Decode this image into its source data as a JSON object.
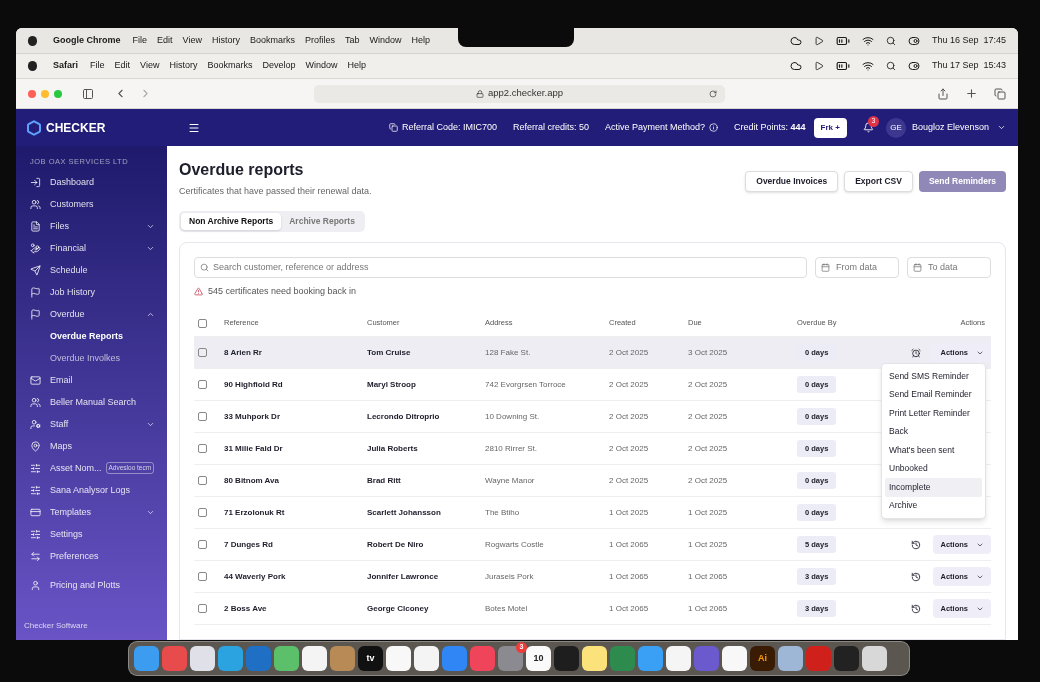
{
  "menubars": [
    {
      "app": "Google Chrome",
      "menus": [
        "File",
        "Edit",
        "View",
        "History",
        "Bookmarks",
        "Profiles",
        "Tab",
        "Window",
        "Help"
      ],
      "clock": "Thu 16 Sep  17:45"
    },
    {
      "app": "Safari",
      "menus": [
        "File",
        "Edit",
        "View",
        "History",
        "Bookmarks",
        "Develop",
        "Window",
        "Help"
      ],
      "clock": "Thu 17 Sep  15:43"
    }
  ],
  "browser": {
    "url": "app2.checker.app"
  },
  "header": {
    "logo": "CHECKER",
    "referral_code": "Referral Code: IMIC700",
    "referral_credits": "Referral credits: 50",
    "payment": "Active Payment Method?",
    "credit_points": "Credit Points: **444**",
    "plan_button": "Frk +",
    "notifications": "3",
    "avatar": "GE",
    "user": "Bougloz Elevenson"
  },
  "sidebar": {
    "company": "JOB OAX SERVICES LTD",
    "items": [
      {
        "label": "Dashboard"
      },
      {
        "label": "Customers"
      },
      {
        "label": "Files",
        "expanded": false
      },
      {
        "label": "Financial",
        "expanded": false
      },
      {
        "label": "Schedule"
      },
      {
        "label": "Job History"
      },
      {
        "label": "Overdue",
        "expanded": true,
        "children": [
          {
            "label": "Overdue Reports",
            "selected": true
          },
          {
            "label": "Overdue Involkes",
            "selected": false
          }
        ]
      },
      {
        "label": "Email"
      },
      {
        "label": "Beller Manual Search"
      },
      {
        "label": "Staff",
        "expanded": false
      },
      {
        "label": "Maps"
      },
      {
        "label": "Asset Nom...",
        "badge": "Advesloo tecm"
      },
      {
        "label": "Sana Analysor Logs"
      },
      {
        "label": "Templates",
        "expanded": false
      },
      {
        "label": "Settings"
      },
      {
        "label": "Preferences"
      },
      {
        "label": "Pricing and Plotts"
      }
    ],
    "footer": "Checker Software"
  },
  "page": {
    "title": "Overdue reports",
    "subtitle": "Certificates that have passed their renewal data.",
    "buttons": [
      {
        "label": "Overdue Invoices",
        "kind": "outline"
      },
      {
        "label": "Export CSV",
        "kind": "outline"
      },
      {
        "label": "Send Reminders",
        "kind": "primary"
      }
    ],
    "tabs": [
      {
        "label": "Non Archive Reports",
        "selected": true
      },
      {
        "label": "Archive Reports",
        "selected": false
      }
    ],
    "search": {
      "placeholder": "Search customer, reference or address"
    },
    "from_date": {
      "placeholder": "From data"
    },
    "to_date": {
      "placeholder": "To data"
    },
    "warning": "545 certificates need booking back in"
  },
  "table": {
    "select_all": {
      "checked": false
    },
    "columns": [
      "Reference",
      "Customer",
      "Address",
      "Created",
      "Due",
      "Overdue By",
      "Actions"
    ],
    "rows": [
      {
        "reference": "8 Arien Rr",
        "customer": "Tom Cruise",
        "address": "128 Fake St.",
        "created": "2 Oct 2025",
        "due": "3 Oct 2025",
        "overdue_by": "0 days",
        "actions": "Actions",
        "selected": true
      },
      {
        "reference": "90 Highfiold Rd",
        "customer": "Maryl Stroop",
        "address": "742 Evorgrsen Torroce",
        "created": "2 Oct 2025",
        "due": "2 Oct 2025",
        "overdue_by": "0 days",
        "selected": false
      },
      {
        "reference": "33 Muhpork Dr",
        "customer": "Lecrondo Ditroprio",
        "address": "10 Downing St.",
        "created": "2 Oct 2025",
        "due": "2 Oct 2025",
        "overdue_by": "0 days",
        "selected": false
      },
      {
        "reference": "31 Milie Fald Dr",
        "customer": "Julia Roberts",
        "address": "2810 Rirrer St.",
        "created": "2 Oct 2025",
        "due": "2 Oct 2025",
        "overdue_by": "0 days",
        "selected": false
      },
      {
        "reference": "80 Bitnom Ava",
        "customer": "Brad Ritt",
        "address": "Wayne Manor",
        "created": "2 Oct 2025",
        "due": "2 Oct 2025",
        "overdue_by": "0 days",
        "selected": false
      },
      {
        "reference": "71 Erzolonuk Rt",
        "customer": "Scarlett Johansson",
        "address": "The Btiho",
        "created": "1 Oct 2025",
        "due": "1 Oct 2025",
        "overdue_by": "0 days",
        "selected": false
      },
      {
        "reference": "7 Dunges Rd",
        "customer": "Robert De Niro",
        "address": "Rogwarts Costle",
        "created": "1 Oct 2065",
        "due": "1 Oct 2025",
        "overdue_by": "5 days",
        "actions": "Actions",
        "selected": false
      },
      {
        "reference": "44 Waverly Pork",
        "customer": "Jonnifer Lawronce",
        "address": "Juraseis Pork",
        "created": "1 Oct 2065",
        "due": "1 Oct 2065",
        "overdue_by": "3 days",
        "actions": "Actions",
        "selected": false
      },
      {
        "reference": "2 Boss Ave",
        "customer": "George Clconey",
        "address": "Botes Motel",
        "created": "1 Oct 2065",
        "due": "1 Oct 2065",
        "overdue_by": "3 days",
        "actions": "Actions",
        "selected": false
      }
    ]
  },
  "actions_menu": {
    "items": [
      {
        "label": "Send SMS Reminder",
        "selected": false
      },
      {
        "label": "Send Email Reminder",
        "selected": false
      },
      {
        "label": "Print Letter Reminder",
        "selected": false
      },
      {
        "label": "Back",
        "selected": false
      },
      {
        "label": "What's been sent",
        "selected": false
      },
      {
        "label": "Unbooked",
        "selected": false
      },
      {
        "label": "Incomplete",
        "selected": true
      },
      {
        "label": "Archive",
        "selected": false
      }
    ]
  },
  "dock": {
    "apps": [
      {
        "color": "#3b9cf0"
      },
      {
        "color": "#e84b4b"
      },
      {
        "color": "#e0e0e8"
      },
      {
        "color": "#2aa3e0"
      },
      {
        "color": "#1f6fc4"
      },
      {
        "color": "#5cbf6a"
      },
      {
        "color": "#f4f4f4"
      },
      {
        "color": "#b88a55"
      },
      {
        "color": "#111111",
        "label": "tv"
      },
      {
        "color": "#f8f8f8"
      },
      {
        "color": "#f4f4f4"
      },
      {
        "color": "#2f86f4"
      },
      {
        "color": "#f0445a"
      },
      {
        "color": "#8a8a90",
        "badge": "3"
      },
      {
        "color": "#fafafa",
        "label": "10"
      },
      {
        "color": "#1e1e1e"
      },
      {
        "color": "#fbe27a"
      },
      {
        "color": "#2e8b4e"
      },
      {
        "color": "#3aa0f5"
      },
      {
        "color": "#f5f5f5"
      },
      {
        "color": "#6a5acd"
      },
      {
        "color": "#f8f8f8"
      },
      {
        "color": "#3a1c05",
        "label": "Ai"
      },
      {
        "color": "#9fb7d6"
      },
      {
        "color": "#d0201c"
      },
      {
        "color": "#222222"
      },
      {
        "color": "#d8d8d8"
      }
    ]
  }
}
